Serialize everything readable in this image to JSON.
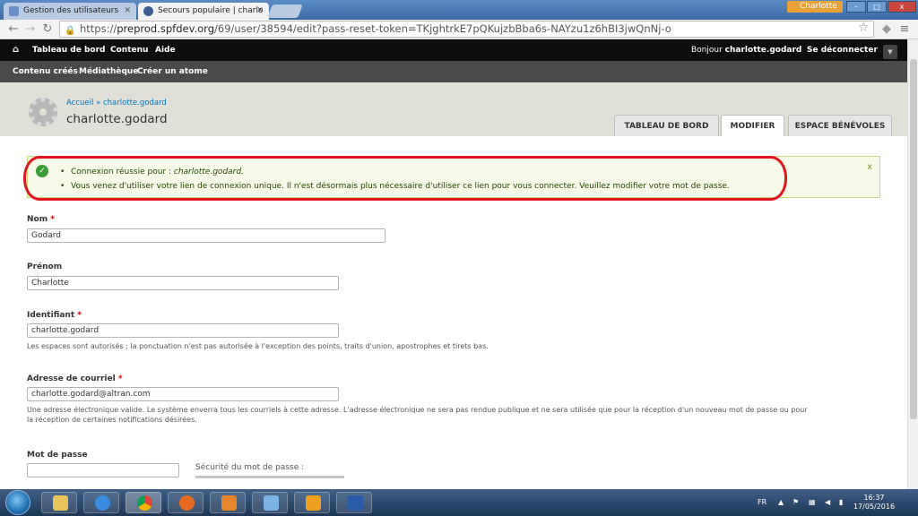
{
  "browser": {
    "tabs": [
      {
        "label": "Gestion des utilisateurs",
        "active": false
      },
      {
        "label": "Secours populaire | charlo",
        "active": true
      }
    ],
    "profile_name": "Charlotte",
    "window_buttons": [
      "–",
      "□",
      "x"
    ],
    "url": {
      "scheme": "https://",
      "host": "preprod.spfdev.org",
      "path": "/69/user/38594/edit?pass-reset-token=TKjghtrkE7pQKujzbBba6s-NAYzu1z6hBI3jwQnNj-o"
    }
  },
  "admin_bar": {
    "home_icon": "home-icon",
    "items": [
      "Tableau de bord",
      "Contenu",
      "Aide"
    ],
    "greeting": "Bonjour",
    "username": "charlotte.godard",
    "logout": "Se déconnecter"
  },
  "shortcuts": [
    "Contenu créés",
    "Médiathèque",
    "Créer un atome"
  ],
  "page": {
    "breadcrumb": [
      "Accueil",
      "charlotte.godard"
    ],
    "breadcrumb_sep": "»",
    "title": "charlotte.godard",
    "tabs": [
      {
        "label": "TABLEAU DE BORD",
        "active": false
      },
      {
        "label": "MODIFIER",
        "active": true
      },
      {
        "label": "ESPACE BÉNÉVOLES",
        "active": false
      }
    ]
  },
  "status_message": {
    "line1_prefix": "Connexion réussie pour :",
    "line1_user": "charlotte.godard.",
    "line2": "Vous venez d'utiliser votre lien de connexion unique. Il n'est désormais plus nécessaire d'utiliser ce lien pour vous connecter. Veuillez modifier votre mot de passe.",
    "close": "x",
    "highlight_color": "#e0141f"
  },
  "form": {
    "nom": {
      "label": "Nom",
      "required": "*",
      "value": "Godard"
    },
    "prenom": {
      "label": "Prénom",
      "value": "Charlotte"
    },
    "identifiant": {
      "label": "Identifiant",
      "required": "*",
      "value": "charlotte.godard",
      "description": "Les espaces sont autorisés ; la ponctuation n'est pas autorisée à l'exception des points, traits d'union, apostrophes et tirets bas."
    },
    "email": {
      "label": "Adresse de courriel",
      "required": "*",
      "value": "charlotte.godard@altran.com",
      "description_1": "Une adresse électronique valide. Le système enverra tous les courriels à cette adresse. L'adresse électronique ne sera pas rendue publique et ne sera utilisée que pour la réception d'un nouveau mot de passe ou pour",
      "description_2": "la réception de certaines notifications désirées."
    },
    "password": {
      "label": "Mot de passe",
      "value": "",
      "strength_label": "Sécurité du mot de passe :"
    }
  },
  "taskbar": {
    "apps": [
      "windows-explorer",
      "internet-explorer",
      "chrome",
      "firefox",
      "media-player",
      "remote-desktop",
      "outlook",
      "word"
    ],
    "lang": "FR",
    "time": "16:37",
    "date": "17/05/2016"
  }
}
